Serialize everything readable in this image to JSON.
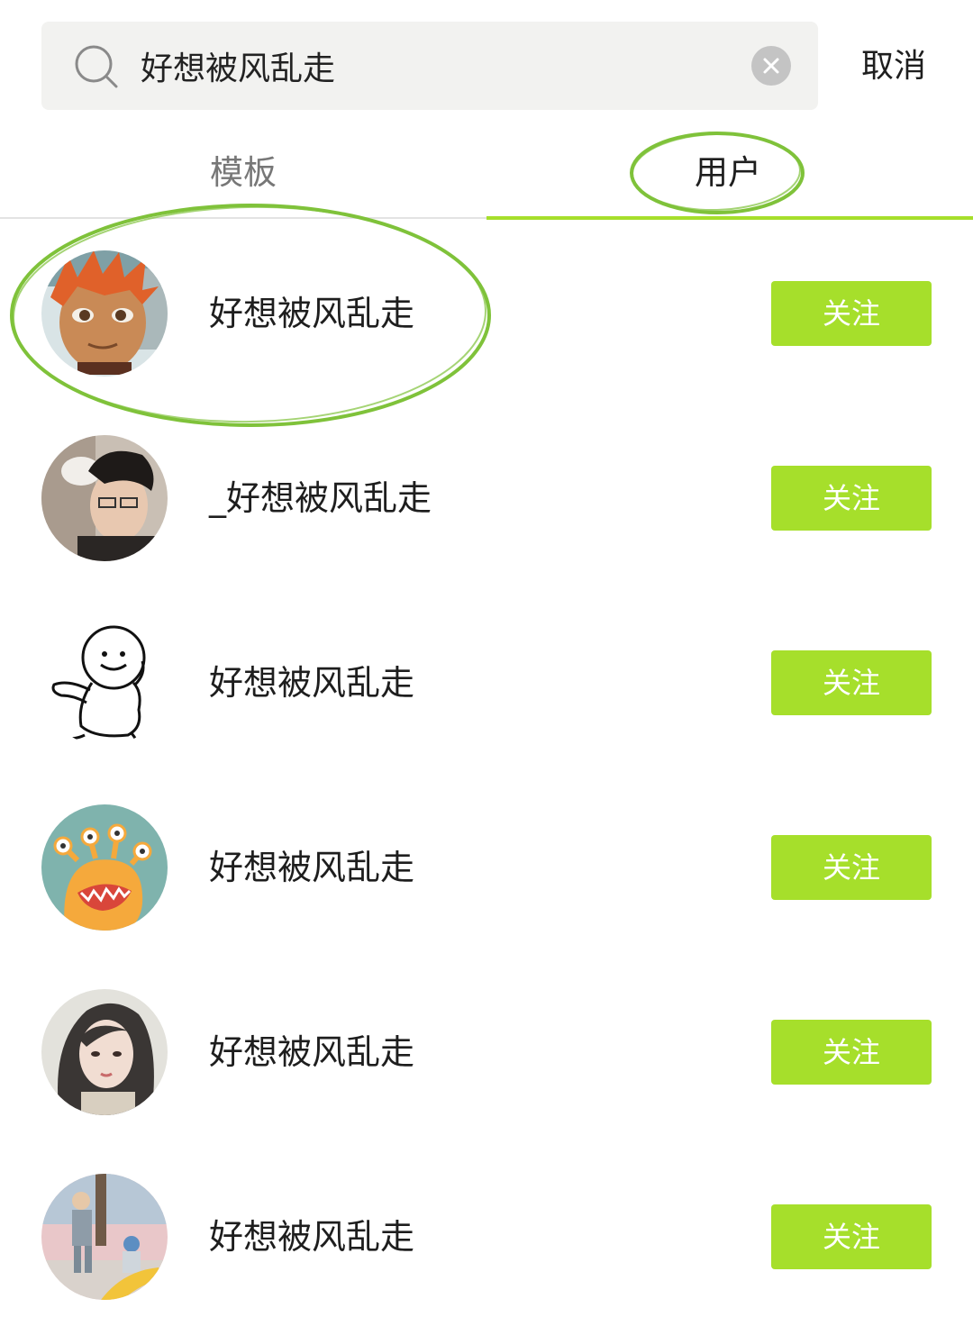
{
  "search": {
    "query": "好想被风乱走",
    "cancel_label": "取消",
    "icon": "search-icon",
    "clear_icon": "clear-icon"
  },
  "tabs": [
    {
      "label": "模板",
      "active": false
    },
    {
      "label": "用户",
      "active": true
    }
  ],
  "users": [
    {
      "name": "好想被风乱走",
      "follow_label": "关注",
      "avatar": "anime-boy-avatar"
    },
    {
      "name": "_好想被风乱走",
      "follow_label": "关注",
      "avatar": "young-man-avatar"
    },
    {
      "name": "好想被风乱走",
      "follow_label": "关注",
      "avatar": "doodle-avatar"
    },
    {
      "name": "好想被风乱走",
      "follow_label": "关注",
      "avatar": "monster-avatar"
    },
    {
      "name": "好想被风乱走",
      "follow_label": "关注",
      "avatar": "illustrated-girl-avatar"
    },
    {
      "name": "好想被风乱走",
      "follow_label": "关注",
      "avatar": "couple-photo-avatar"
    }
  ],
  "colors": {
    "accent": "#a6df2b",
    "annotation": "#7fc23a",
    "search_bg": "#f2f2f0",
    "inactive_tab": "#777777",
    "text": "#1e1e1e"
  }
}
